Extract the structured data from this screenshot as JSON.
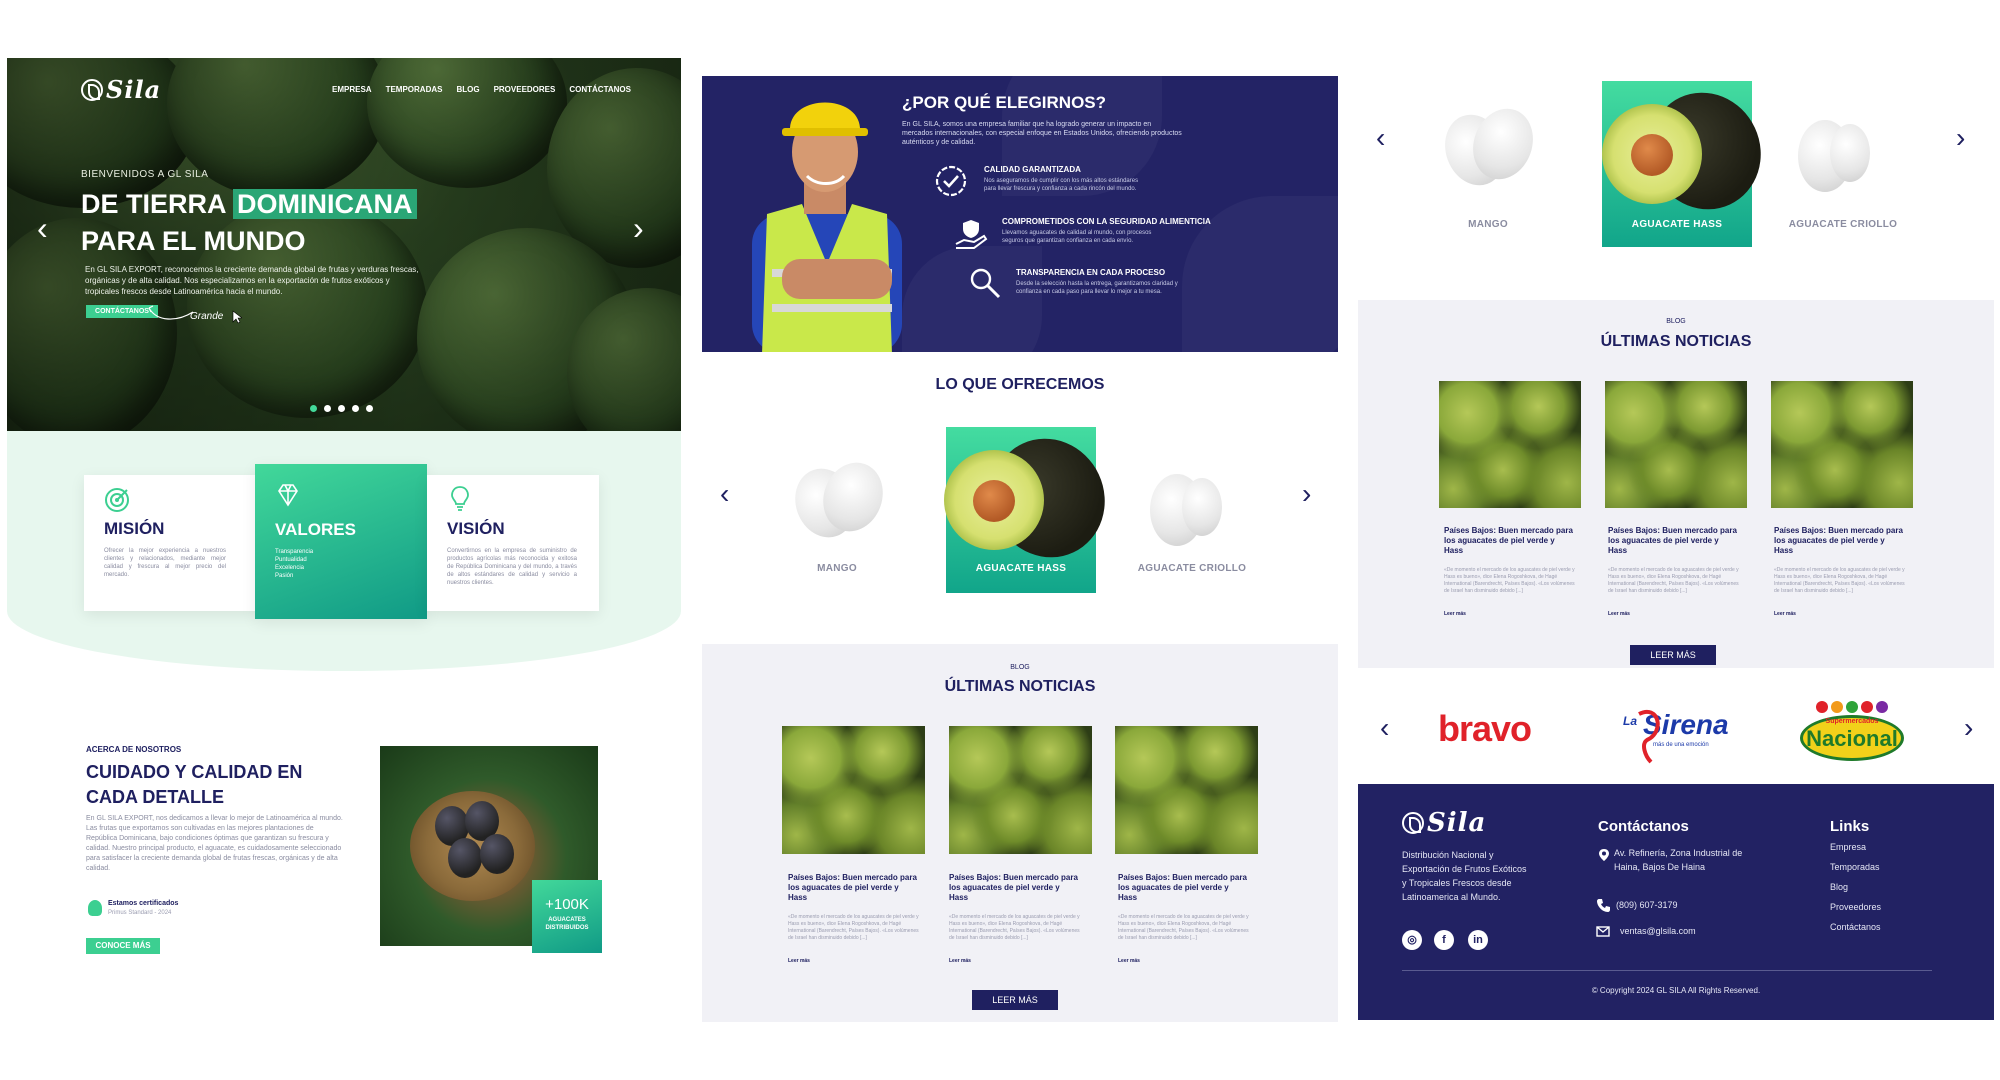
{
  "brand": {
    "logo_text": "Sila"
  },
  "nav": [
    "EMPRESA",
    "TEMPORADAS",
    "BLOG",
    "PROVEEDORES",
    "CONTÁCTANOS"
  ],
  "hero": {
    "welcome": "BIENVENIDOS A GL SILA",
    "title_line1_a": "DE TIERRA",
    "title_line1_b": "DOMINICANA",
    "title_line2": "PARA EL MUNDO",
    "description": "En GL SILA EXPORT, reconocemos la creciente demanda global de frutas y verduras frescas, orgánicas y de alta calidad. Nos especializamos en la exportación de frutos exóticos y tropicales frescos desde Latinoamérica hacia el mundo.",
    "cta": "CONTÁCTANOS",
    "annotation": "Grande",
    "slides": 5
  },
  "mvv": {
    "mision": {
      "title": "MISIÓN",
      "text": "Ofrecer la mejor experiencia a nuestros clientes y relacionados, mediante mejor calidad y frescura al mejor precio del mercado."
    },
    "valores": {
      "title": "VALORES",
      "items": [
        "Transparencia",
        "Puntualidad",
        "Excelencia",
        "Pasión"
      ]
    },
    "vision": {
      "title": "VISIÓN",
      "text": "Convertirnos en la empresa de suministro de productos agrícolas más reconocida y exitosa de República Dominicana y del mundo, a través de altos estándares de calidad y servicio a nuestros clientes."
    }
  },
  "about": {
    "caption": "ACERCA DE NOSOTROS",
    "title": "CUIDADO Y CALIDAD EN CADA DETALLE",
    "text": "En GL SILA EXPORT, nos dedicamos a llevar lo mejor de Latinoamérica al mundo. Las frutas que exportamos son cultivadas en las mejores plantaciones de República Dominicana, bajo condiciones óptimas que garantizan su frescura y calidad. Nuestro principal producto, el aguacate, es cuidadosamente seleccionado para satisfacer la creciente demanda global de frutas frescas, orgánicas y de alta calidad.",
    "cert_title": "Estamos certificados",
    "cert_sub": "Primus Standard - 2024",
    "cta": "CONOCE MÁS",
    "stat_value": "+100K",
    "stat_label": "AGUACATES DISTRIBUIDOS"
  },
  "why": {
    "title": "¿POR QUÉ ELEGIRNOS?",
    "intro": "En GL SILA, somos una empresa familiar que ha logrado generar un impacto en mercados internacionales, con especial enfoque en Estados Unidos, ofreciendo productos auténticos y de calidad.",
    "features": [
      {
        "title": "CALIDAD GARANTIZADA",
        "text": "Nos aseguramos de cumplir con los más altos estándares para llevar frescura y confianza a cada rincón del mundo."
      },
      {
        "title": "COMPROMETIDOS CON LA SEGURIDAD ALIMENTICIA",
        "text": "Llevamos aguacates de calidad al mundo, con procesos seguros que garantizan confianza en cada envío."
      },
      {
        "title": "TRANSPARENCIA EN CADA PROCESO",
        "text": "Desde la selección hasta la entrega, garantizamos claridad y confianza en cada paso para llevar lo mejor a tu mesa."
      }
    ]
  },
  "offer": {
    "title": "LO QUE OFRECEMOS",
    "products": [
      "MANGO",
      "AGUACATE HASS",
      "AGUACATE CRIOLLO"
    ]
  },
  "news": {
    "caption": "BLOG",
    "title": "ÚLTIMAS NOTICIAS",
    "cta": "LEER MÁS",
    "read_more": "Leer más",
    "items": [
      {
        "title": "Países Bajos: Buen mercado para los aguacates de piel verde y Hass",
        "text": "«De momento el mercado de los aguacates de piel verde y Hass es bueno», dice Elena Rogoshkova, de Hagé International (Barendrecht, Países Bajos). «Los volúmenes de Israel han disminuido debido [...]"
      },
      {
        "title": "Países Bajos: Buen mercado para los aguacates de piel verde y Hass",
        "text": "«De momento el mercado de los aguacates de piel verde y Hass es bueno», dice Elena Rogoshkova, de Hagé International (Barendrecht, Países Bajos). «Los volúmenes de Israel han disminuido debido [...]"
      },
      {
        "title": "Países Bajos: Buen mercado para los aguacates de piel verde y Hass",
        "text": "«De momento el mercado de los aguacates de piel verde y Hass es bueno», dice Elena Rogoshkova, de Hagé International (Barendrecht, Países Bajos). «Los volúmenes de Israel han disminuido debido [...]"
      }
    ]
  },
  "clients": {
    "bravo": "bravo",
    "sirena": "Sirena",
    "sirena_pre": "La",
    "sirena_sub": "más de una emoción",
    "nacional": "Nacional",
    "nacional_pre": "Supermercados"
  },
  "footer": {
    "tagline": "Distribución Nacional y Exportación de Frutos Exóticos y Tropicales Frescos desde Latinoamerica al Mundo.",
    "contact_title": "Contáctanos",
    "address": "Av. Refinería, Zona Industrial de Haina, Bajos De Haina",
    "phone": "(809) 607-3179",
    "email": "ventas@glsila.com",
    "links_title": "Links",
    "links": [
      "Empresa",
      "Temporadas",
      "Blog",
      "Proveedores",
      "Contáctanos"
    ],
    "copyright": "© Copyright 2024 GL SILA All Rights Reserved."
  },
  "colors": {
    "navy": "#1f2060",
    "green": "#3ccf91",
    "teal": "#109a86",
    "mint": "#e7f7ee"
  }
}
